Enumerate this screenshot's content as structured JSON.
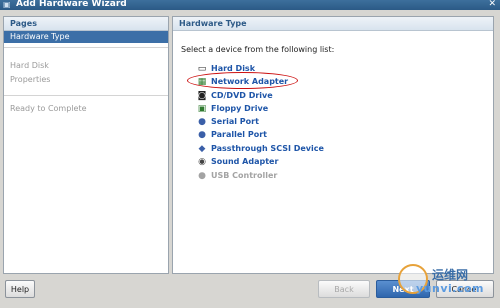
{
  "window": {
    "title": "Add Hardware Wizard",
    "close_glyph": "✕"
  },
  "left_panel": {
    "header": "Pages",
    "items": [
      {
        "label": "Hardware Type",
        "selected": true
      },
      {
        "label": "Hard Disk",
        "selected": false
      },
      {
        "label": "Properties",
        "selected": false
      },
      {
        "label": "Ready to Complete",
        "selected": false
      }
    ]
  },
  "right_panel": {
    "header": "Hardware Type",
    "prompt": "Select a device from the following list:",
    "devices": [
      {
        "label": "Hard Disk",
        "icon": "hard-disk-icon",
        "enabled": true
      },
      {
        "label": "Network Adapter",
        "icon": "network-adapter-icon",
        "enabled": true,
        "highlighted": true
      },
      {
        "label": "CD/DVD Drive",
        "icon": "cd-dvd-icon",
        "enabled": true
      },
      {
        "label": "Floppy Drive",
        "icon": "floppy-icon",
        "enabled": true
      },
      {
        "label": "Serial Port",
        "icon": "serial-port-icon",
        "enabled": true
      },
      {
        "label": "Parallel Port",
        "icon": "parallel-port-icon",
        "enabled": true
      },
      {
        "label": "Passthrough SCSI Device",
        "icon": "scsi-icon",
        "enabled": true
      },
      {
        "label": "Sound Adapter",
        "icon": "sound-icon",
        "enabled": true
      },
      {
        "label": "USB Controller",
        "icon": "usb-icon",
        "enabled": false
      }
    ]
  },
  "buttons": {
    "help": "Help",
    "back": "Back",
    "next": "Next",
    "cancel": "Cancel"
  },
  "watermark": {
    "cn": "运维网",
    "en": "yunvi.com"
  },
  "colors": {
    "accent": "#3c6fa7",
    "link": "#1e55a8",
    "highlight": "#cc1111"
  }
}
